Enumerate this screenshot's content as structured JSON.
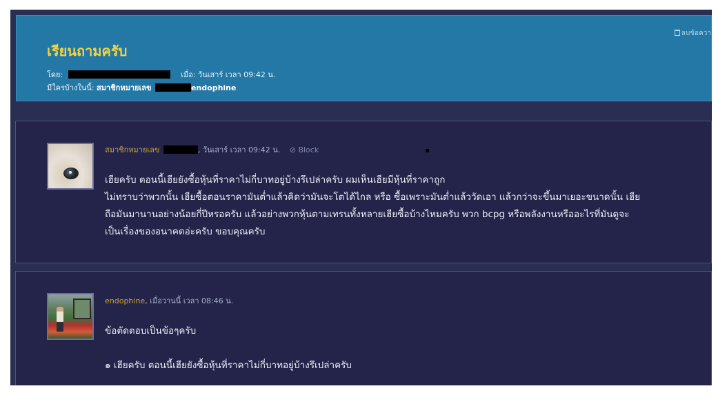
{
  "topic": {
    "delete_label": "ลบข้อควา",
    "title": "เรียนถามครับ",
    "by_label": "โดย:",
    "when": "เมื่อ: วันเสาร์ เวลา 09:42 น.",
    "viewers_label": "มีใครบ้างในนี้:",
    "viewer_member": "สมาชิกหมายเลข",
    "viewer_name": "endophine"
  },
  "posts": [
    {
      "author": "สมาชิกหมายเลข",
      "time": ", วันเสาร์ เวลา 09:42 น.",
      "block_label": "Block",
      "lines": [
        "เฮียครับ ตอนนี้เฮียยังซื้อหุ้นที่ราคาไม่กี่บาทอยู่บ้างรึเปล่าครับ  ผมเห็นเฮียมีหุ้นที่ราคาถูก",
        "ไม่ทราบว่าพวกนั้น เฮียซื้อตอนราคามันต่ำแล้วคิดว่ามันจะโตได้ไกล หรือ ซื้อเพราะมันต่ำแล้ววัดเอา แล้วกว่าจะขึ้นมาเยอะขนาดนั้น เฮีย",
        "ถือมันมานานอย่างน้อยกี่ปีหรอครับ  แล้วอย่างพวกหุ้นตามเทรนทั้งหลายเฮียซื้อบ้างไหมครับ พวก bcpg หรือพลังงานหรืออะไรที่มันดูจะ",
        "เป็นเรื่องของอนาคตอ่ะครับ ขอบคุณครับ"
      ]
    },
    {
      "author": "endophine",
      "time": ", เมื่อวานนี้ เวลา 08:46 น.",
      "lines": [
        "ข้อตัดตอบเป็นข้อๆครับ",
        "",
        "๑ เฮียครับ ตอนนี้เฮียยังซื้อหุ้นที่ราคาไม่กี่บาทอยู่บ้างรึเปล่าครับ"
      ]
    }
  ]
}
